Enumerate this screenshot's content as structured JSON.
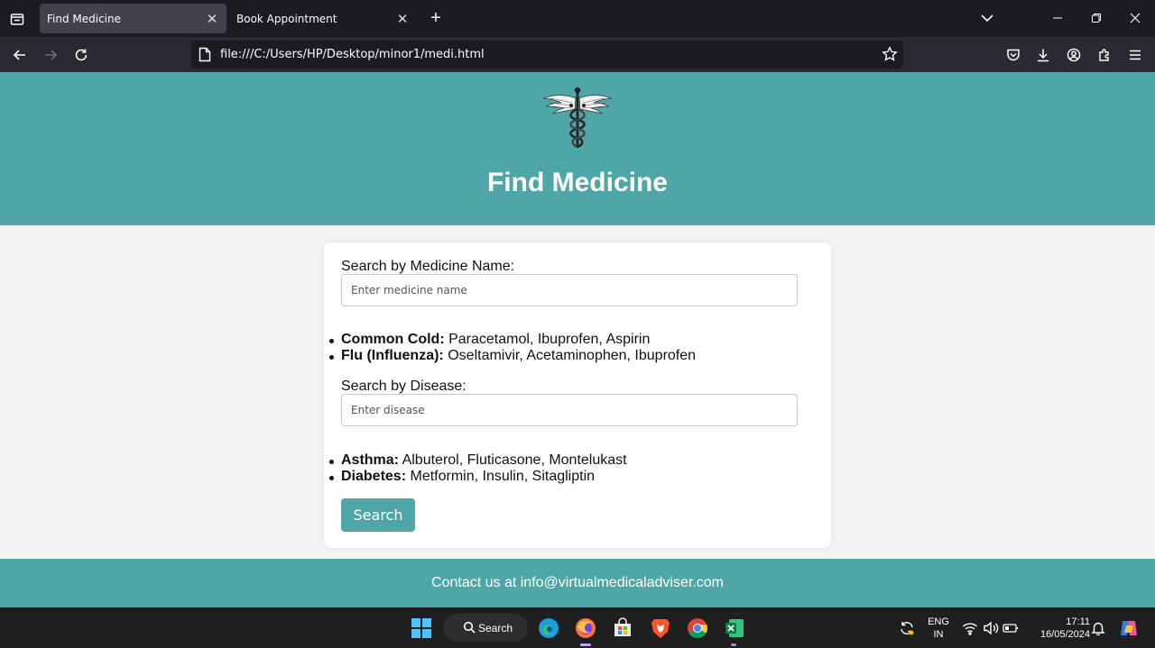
{
  "browser": {
    "tabs": [
      {
        "title": "Find Medicine",
        "active": true
      },
      {
        "title": "Book Appointment",
        "active": false
      }
    ],
    "url": "file:///C:/Users/HP/Desktop/minor1/medi.html"
  },
  "page": {
    "title": "Find Medicine",
    "medicine_search": {
      "label": "Search by Medicine Name:",
      "placeholder": "Enter medicine name",
      "value": ""
    },
    "list1": [
      {
        "name": "Common Cold:",
        "meds": "Paracetamol, Ibuprofen, Aspirin"
      },
      {
        "name": "Flu (Influenza):",
        "meds": "Oseltamivir, Acetaminophen, Ibuprofen"
      }
    ],
    "disease_search": {
      "label": "Search by Disease:",
      "placeholder": "Enter disease",
      "value": ""
    },
    "list2": [
      {
        "name": "Asthma:",
        "meds": "Albuterol, Fluticasone, Montelukast"
      },
      {
        "name": "Diabetes:",
        "meds": "Metformin, Insulin, Sitagliptin"
      }
    ],
    "search_button": "Search",
    "footer": "Contact us at info@virtualmedicaladviser.com"
  },
  "taskbar": {
    "search_label": "Search",
    "language": "ENG",
    "region": "IN",
    "time": "17:11",
    "date": "16/05/2024"
  },
  "colors": {
    "accent": "#4fa6a6",
    "chrome_dark": "#1c1b22",
    "toolbar": "#2b2a33"
  },
  "icons": {
    "taskbar_apps": [
      "windows-start-icon",
      "edge-icon",
      "firefox-icon",
      "store-icon",
      "brave-icon",
      "chrome-icon",
      "excel-icon"
    ],
    "page_logo": "caduceus-logo"
  }
}
